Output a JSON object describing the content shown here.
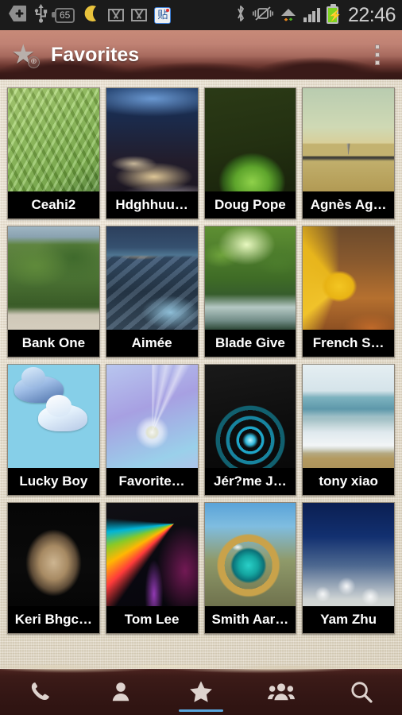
{
  "statusbar": {
    "icons": [
      {
        "name": "add-icon",
        "label": "+"
      },
      {
        "name": "usb-icon",
        "label": "USB"
      },
      {
        "name": "battery-percent-icon",
        "label": "65"
      },
      {
        "name": "moon-icon",
        "label": "moon"
      },
      {
        "name": "gmail-icon-1",
        "label": "M"
      },
      {
        "name": "gmail-icon-2",
        "label": "M"
      },
      {
        "name": "tieba-icon",
        "label": "贴"
      },
      {
        "name": "bluetooth-icon",
        "label": "bluetooth"
      },
      {
        "name": "vibrate-off-icon",
        "label": "vibrate-off"
      },
      {
        "name": "wifi-data-icon",
        "label": "wifi"
      },
      {
        "name": "signal-icon",
        "label": "signal"
      },
      {
        "name": "battery-charging-icon",
        "label": "battery"
      }
    ],
    "clock": "22:46",
    "battery_percent": "65",
    "tieba_glyph": "贴"
  },
  "actionbar": {
    "title": "Favorites",
    "star_glyph": "★",
    "badge_glyph": "⊕",
    "overflow_label": "More options"
  },
  "colors": {
    "accent": "#5aa8e0",
    "actionbar_top": "#c88a78",
    "actionbar_bottom": "#331715",
    "bottombar": "#331614",
    "paper": "#e6ddcb",
    "label_bg": "#000000",
    "label_text": "#ffffff"
  },
  "grid": {
    "columns": 4,
    "items": [
      {
        "name": "Ceahi2",
        "art": "art-fern"
      },
      {
        "name": "Hdghhuu…",
        "art": "art-roadnight"
      },
      {
        "name": "Doug Pope",
        "art": "art-beetle"
      },
      {
        "name": "Agnès Ag…",
        "art": "art-road"
      },
      {
        "name": "Bank One",
        "art": "art-forest"
      },
      {
        "name": "Aimée",
        "art": "art-shore"
      },
      {
        "name": "Blade Give",
        "art": "art-waterfall"
      },
      {
        "name": "French S…",
        "art": "art-leaf"
      },
      {
        "name": "Lucky Boy",
        "art": "art-clouds"
      },
      {
        "name": "Favorite…",
        "art": "art-dandelion-violet"
      },
      {
        "name": "Jér?me J…",
        "art": "art-cyanring"
      },
      {
        "name": "tony xiao",
        "art": "art-beach"
      },
      {
        "name": "Keri Bhgc…",
        "art": "art-wolf"
      },
      {
        "name": "Tom Lee",
        "art": "art-neon"
      },
      {
        "name": "Smith Aar…",
        "art": "art-eye"
      },
      {
        "name": "Yam Zhu",
        "art": "art-dandelion-blue"
      }
    ]
  },
  "bottomnav": {
    "items": [
      {
        "label": "Phone",
        "icon": "phone-icon",
        "selected": false
      },
      {
        "label": "Contacts",
        "icon": "person-icon",
        "selected": false
      },
      {
        "label": "Favorites",
        "icon": "star-icon",
        "selected": true
      },
      {
        "label": "Groups",
        "icon": "group-icon",
        "selected": false
      },
      {
        "label": "Search",
        "icon": "search-icon",
        "selected": false
      }
    ]
  }
}
